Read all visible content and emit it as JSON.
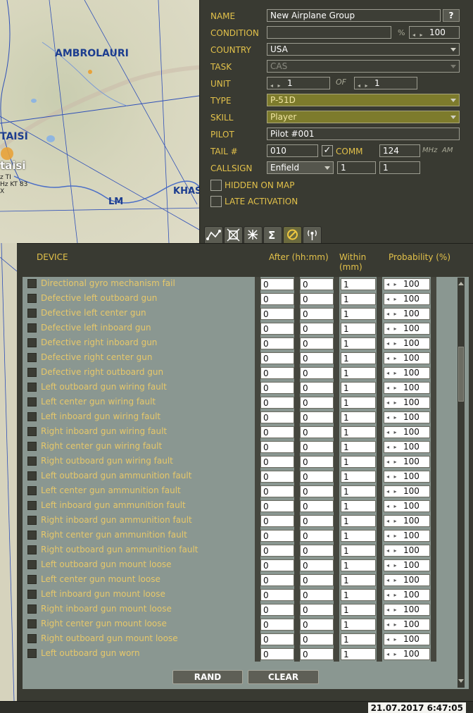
{
  "map": {
    "labels": [
      "AMBROLAURI",
      "TAISI",
      "taisi",
      "LM",
      "KHAS"
    ],
    "small_lines": [
      "z TI",
      "Hz KT 83",
      "X"
    ]
  },
  "props": {
    "name_label": "NAME",
    "name_value": "New Airplane Group",
    "help": "?",
    "condition_label": "CONDITION",
    "condition_value": "",
    "percent": "%",
    "condition_pct": "100",
    "country_label": "COUNTRY",
    "country_value": "USA",
    "task_label": "TASK",
    "task_value": "CAS",
    "unit_label": "UNIT",
    "unit_value": "1",
    "of_label": "OF",
    "unit_of_value": "1",
    "type_label": "TYPE",
    "type_value": "P-51D",
    "skill_label": "SKILL",
    "skill_value": "Player",
    "pilot_label": "PILOT",
    "pilot_value": "Pilot #001",
    "tail_label": "TAIL #",
    "tail_value": "010",
    "comm_check": "✓",
    "comm_label": "COMM",
    "comm_value": "124",
    "mhz": "MHz",
    "am": "AM",
    "callsign_label": "CALLSIGN",
    "callsign_value": "Enfield",
    "callsign_num1": "1",
    "callsign_num2": "1",
    "hidden_label": "HIDDEN ON MAP",
    "late_label": "LATE ACTIVATION"
  },
  "tabs": [
    {
      "name": "route-tab",
      "icon": "route-icon",
      "glyph": "⩘"
    },
    {
      "name": "targets-tab",
      "icon": "target-icon",
      "glyph": "⌖"
    },
    {
      "name": "payload-tab",
      "icon": "payload-icon",
      "glyph": "⌘"
    },
    {
      "name": "summary-tab",
      "icon": "sigma-icon",
      "glyph": "Σ"
    },
    {
      "name": "failures-tab",
      "icon": "failures-icon",
      "glyph": "⊘"
    },
    {
      "name": "radio-tab",
      "icon": "radio-icon",
      "glyph": "((•))"
    }
  ],
  "failures": {
    "col_device": "DEVICE",
    "col_after": "After (hh:mm)",
    "col_within": "Within (mm)",
    "col_within_1": "Within",
    "col_within_2": "(mm)",
    "col_probability": "Probability (%)",
    "rows": [
      {
        "name": "Directional gyro mechanism fail",
        "h": "0",
        "m": "0",
        "within": "1",
        "prob": "100"
      },
      {
        "name": "Defective left outboard gun",
        "h": "0",
        "m": "0",
        "within": "1",
        "prob": "100"
      },
      {
        "name": "Defective left center gun",
        "h": "0",
        "m": "0",
        "within": "1",
        "prob": "100"
      },
      {
        "name": "Defective left inboard gun",
        "h": "0",
        "m": "0",
        "within": "1",
        "prob": "100"
      },
      {
        "name": "Defective right inboard gun",
        "h": "0",
        "m": "0",
        "within": "1",
        "prob": "100"
      },
      {
        "name": "Defective right center gun",
        "h": "0",
        "m": "0",
        "within": "1",
        "prob": "100"
      },
      {
        "name": "Defective right outboard gun",
        "h": "0",
        "m": "0",
        "within": "1",
        "prob": "100"
      },
      {
        "name": "Left outboard gun wiring fault",
        "h": "0",
        "m": "0",
        "within": "1",
        "prob": "100"
      },
      {
        "name": "Left center gun wiring fault",
        "h": "0",
        "m": "0",
        "within": "1",
        "prob": "100"
      },
      {
        "name": "Left inboard gun wiring fault",
        "h": "0",
        "m": "0",
        "within": "1",
        "prob": "100"
      },
      {
        "name": "Right inboard gun wiring fault",
        "h": "0",
        "m": "0",
        "within": "1",
        "prob": "100"
      },
      {
        "name": "Right center gun wiring fault",
        "h": "0",
        "m": "0",
        "within": "1",
        "prob": "100"
      },
      {
        "name": "Right outboard gun wiring fault",
        "h": "0",
        "m": "0",
        "within": "1",
        "prob": "100"
      },
      {
        "name": "Left outboard gun ammunition fault",
        "h": "0",
        "m": "0",
        "within": "1",
        "prob": "100"
      },
      {
        "name": "Left center gun ammunition fault",
        "h": "0",
        "m": "0",
        "within": "1",
        "prob": "100"
      },
      {
        "name": "Left inboard gun ammunition fault",
        "h": "0",
        "m": "0",
        "within": "1",
        "prob": "100"
      },
      {
        "name": "Right inboard gun ammunition fault",
        "h": "0",
        "m": "0",
        "within": "1",
        "prob": "100"
      },
      {
        "name": "Right center gun ammunition fault",
        "h": "0",
        "m": "0",
        "within": "1",
        "prob": "100"
      },
      {
        "name": "Right outboard gun ammunition fault",
        "h": "0",
        "m": "0",
        "within": "1",
        "prob": "100"
      },
      {
        "name": "Left outboard gun mount loose",
        "h": "0",
        "m": "0",
        "within": "1",
        "prob": "100"
      },
      {
        "name": "Left center gun mount loose",
        "h": "0",
        "m": "0",
        "within": "1",
        "prob": "100"
      },
      {
        "name": "Left inboard gun mount loose",
        "h": "0",
        "m": "0",
        "within": "1",
        "prob": "100"
      },
      {
        "name": "Right inboard gun mount loose",
        "h": "0",
        "m": "0",
        "within": "1",
        "prob": "100"
      },
      {
        "name": "Right center gun mount loose",
        "h": "0",
        "m": "0",
        "within": "1",
        "prob": "100"
      },
      {
        "name": "Right outboard gun mount loose",
        "h": "0",
        "m": "0",
        "within": "1",
        "prob": "100"
      },
      {
        "name": "Left outboard gun worn",
        "h": "0",
        "m": "0",
        "within": "1",
        "prob": "100"
      }
    ],
    "rand_button": "RAND",
    "clear_button": "CLEAR"
  },
  "status": {
    "datetime": "21.07.2017 6:47:05"
  }
}
